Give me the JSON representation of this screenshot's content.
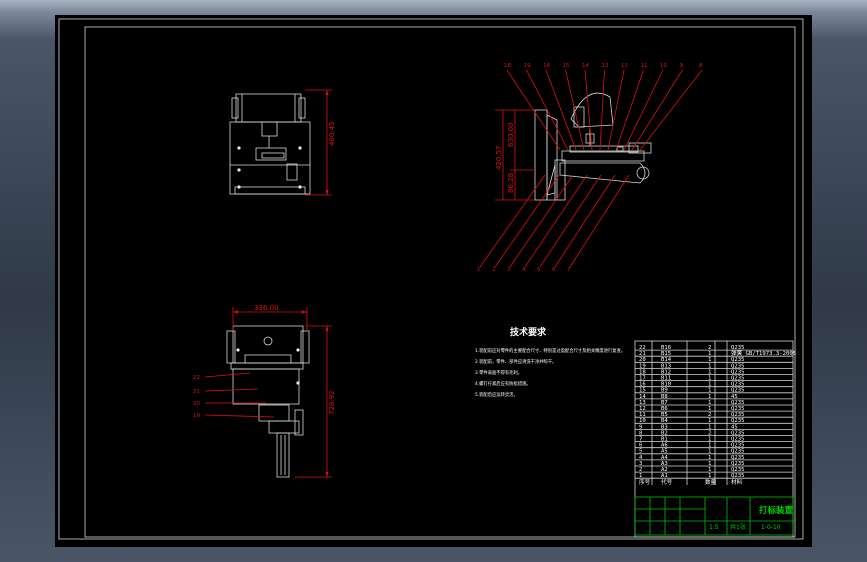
{
  "drawing": {
    "dim_front_height": "400.45",
    "dim_side_a": "420.57",
    "dim_side_b": "630.00",
    "dim_side_c": "86.28",
    "dim_top_width": "336.00",
    "dim_top_height": "728.92",
    "notes_title": "技术要求",
    "notes": [
      "1.装配前应对零件的主要配合尺寸、特别是过盈配合尺寸及相关精度进行复查。",
      "2.装配前，零件、部件应清洗干净并晾干。",
      "3.零件表面不得有毛刺。",
      "4.螺钉拧紧后应有防松措施。",
      "5.装配后应运转灵活。"
    ],
    "side_callouts_top": [
      "18",
      "19",
      "16",
      "15",
      "14",
      "13",
      "12",
      "11",
      "10",
      "9",
      "8"
    ],
    "side_callouts_bottom": [
      "1",
      "2",
      "3",
      "4",
      "5",
      "6",
      "7"
    ],
    "top_callouts": [
      "22",
      "21",
      "20",
      "19"
    ],
    "title_block_name": "打标装置",
    "title_block_code": "1-0-10",
    "title_block_scale": "1:5",
    "title_block_sheet": "共1张"
  },
  "bom": {
    "rows": [
      {
        "no": "22",
        "code": "B16",
        "qty": "2",
        "note": "Q235"
      },
      {
        "no": "21",
        "code": "B15",
        "qty": "1",
        "note": "弹簧 GB/T1973.3-2005"
      },
      {
        "no": "20",
        "code": "B14",
        "qty": "1",
        "note": "Q235"
      },
      {
        "no": "19",
        "code": "B13",
        "qty": "1",
        "note": "Q235"
      },
      {
        "no": "18",
        "code": "B12",
        "qty": "1",
        "note": "Q235"
      },
      {
        "no": "17",
        "code": "B11",
        "qty": "1",
        "note": "Q235"
      },
      {
        "no": "16",
        "code": "B10",
        "qty": "1",
        "note": "Q235"
      },
      {
        "no": "15",
        "code": "B9",
        "qty": "1",
        "note": "Q235"
      },
      {
        "no": "14",
        "code": "B8",
        "qty": "1",
        "note": "45"
      },
      {
        "no": "13",
        "code": "B7",
        "qty": "1",
        "note": "Q235"
      },
      {
        "no": "12",
        "code": "B6",
        "qty": "1",
        "note": "Q235"
      },
      {
        "no": "11",
        "code": "B5",
        "qty": "2",
        "note": "Q235"
      },
      {
        "no": "10",
        "code": "B4",
        "qty": "1",
        "note": "Q235"
      },
      {
        "no": "9",
        "code": "B3",
        "qty": "1",
        "note": "45"
      },
      {
        "no": "8",
        "code": "B2",
        "qty": "2",
        "note": "Q235"
      },
      {
        "no": "7",
        "code": "B1",
        "qty": "1",
        "note": "Q235"
      },
      {
        "no": "6",
        "code": "A6",
        "qty": "1",
        "note": "Q235"
      },
      {
        "no": "5",
        "code": "A5",
        "qty": "1",
        "note": "Q235"
      },
      {
        "no": "4",
        "code": "A4",
        "qty": "1",
        "note": "Q235"
      },
      {
        "no": "3",
        "code": "A3",
        "qty": "1",
        "note": "Q235"
      },
      {
        "no": "2",
        "code": "A2",
        "qty": "1",
        "note": "Q235"
      },
      {
        "no": "1",
        "code": "A1",
        "qty": "1",
        "note": "Q235"
      }
    ],
    "header": {
      "no": "序号",
      "code": "代号",
      "qty": "数量",
      "note": "材料"
    }
  }
}
